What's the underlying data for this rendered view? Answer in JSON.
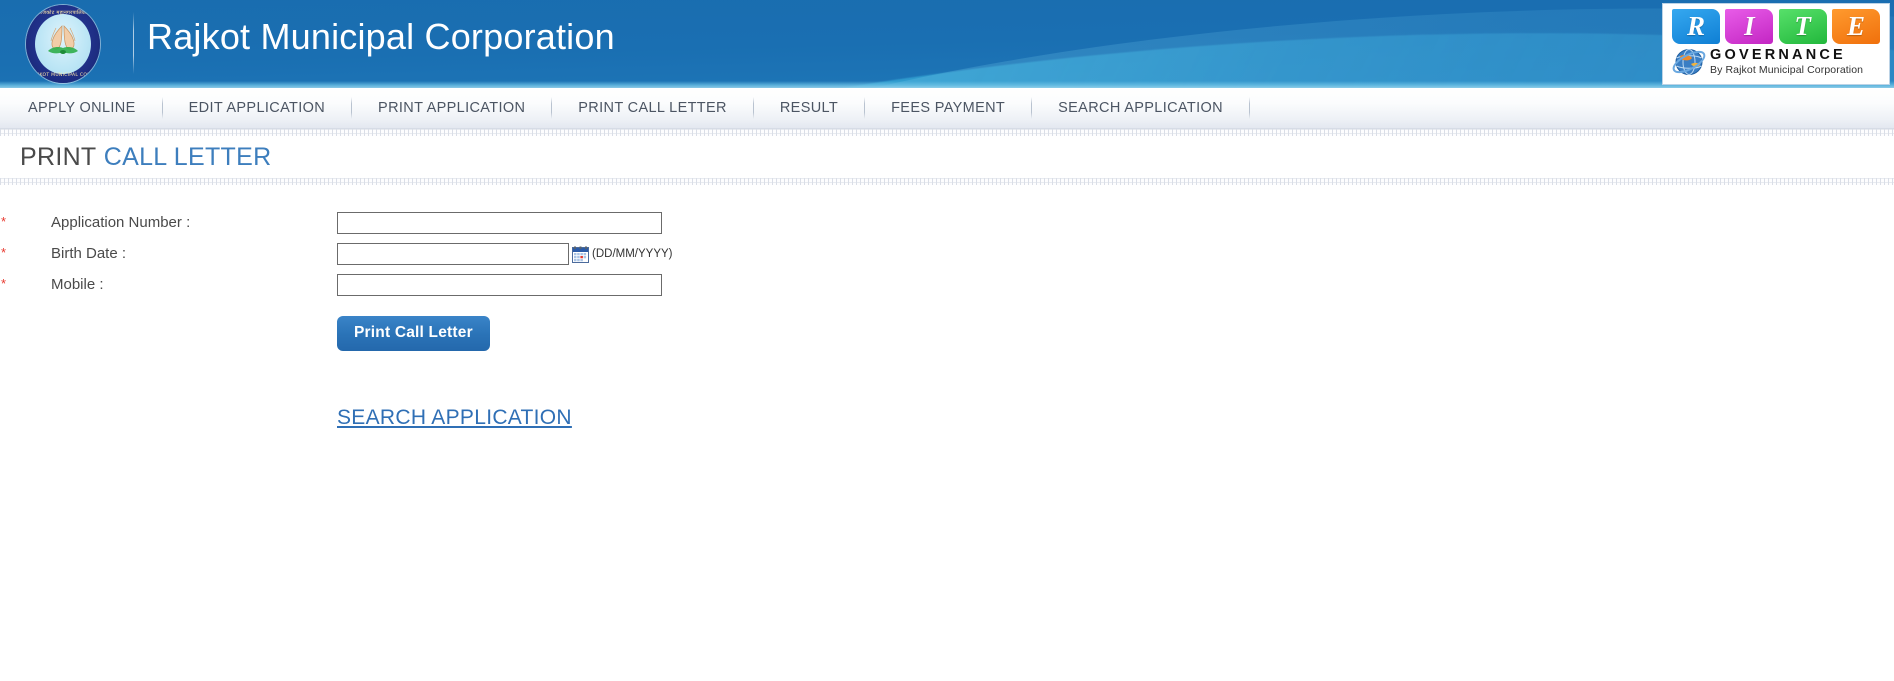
{
  "header": {
    "site_title": "Rajkot Municipal Corporation",
    "emblem": {
      "name": "rajkot-municipal-corporation-emblem",
      "text_top": "राजकोट महानगरपालिका",
      "text_bottom": "RAJKOT MUNICIPAL CORP."
    },
    "brand_logo": {
      "letters": [
        "R",
        "I",
        "T",
        "E"
      ],
      "letter_colors": [
        "#1285d8",
        "#c326c3",
        "#22b83c",
        "#f0700c"
      ],
      "title": "GOVERNANCE",
      "subtitle": "By Rajkot Municipal Corporation"
    }
  },
  "nav": {
    "items": [
      {
        "label": "APPLY ONLINE"
      },
      {
        "label": "EDIT APPLICATION"
      },
      {
        "label": "PRINT APPLICATION"
      },
      {
        "label": "PRINT CALL LETTER"
      },
      {
        "label": "RESULT"
      },
      {
        "label": "FEES PAYMENT"
      },
      {
        "label": "SEARCH APPLICATION"
      }
    ]
  },
  "page": {
    "title_part1": "PRINT",
    "title_part2": "CALL LETTER"
  },
  "form": {
    "required_marker": "*",
    "fields": [
      {
        "label": "Application Number :",
        "value": "",
        "placeholder": ""
      },
      {
        "label": "Birth Date :",
        "value": "",
        "placeholder": "",
        "hint": "(DD/MM/YYYY)",
        "icon": "calendar-icon"
      },
      {
        "label": "Mobile :",
        "value": "",
        "placeholder": ""
      }
    ],
    "submit_label": "Print Call Letter",
    "search_link_label": "SEARCH APPLICATION"
  },
  "colors": {
    "header_blue": "#1a72ba",
    "header_cyan": "#2e93c8",
    "accent_blue": "#2b74b8",
    "link_blue": "#2f6fb5",
    "title_blue": "#3d7ebd",
    "required_red": "#e8392f"
  }
}
